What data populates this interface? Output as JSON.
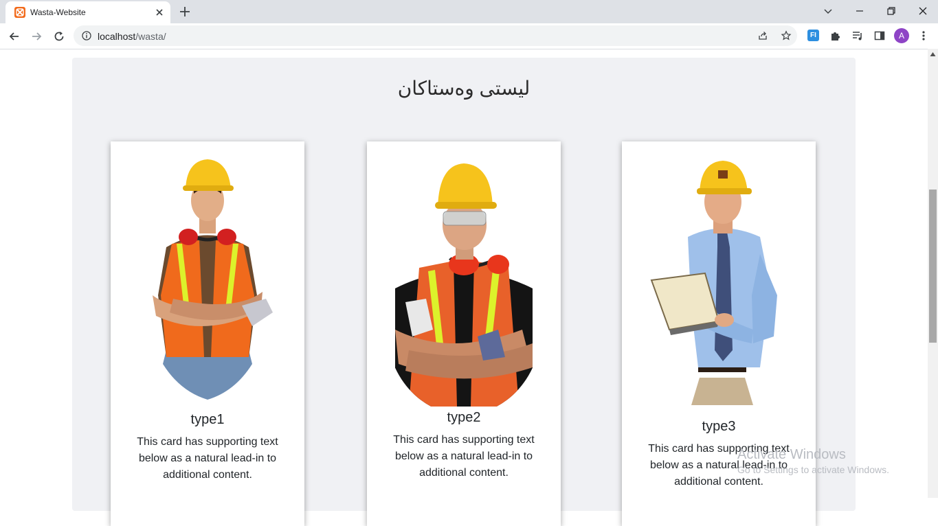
{
  "browser": {
    "tab_title": "Wasta-Website",
    "url_host": "localhost",
    "url_path": "/wasta/",
    "profile_initial": "A",
    "extension_label": "FI"
  },
  "page": {
    "heading": "لیستی وەستاکان",
    "cards": [
      {
        "title": "type1",
        "text": "This card has supporting text below as a natural lead-in to additional content.",
        "image": "worker-orange-vest-crossed-arms"
      },
      {
        "title": "type2",
        "text": "This card has supporting text below as a natural lead-in to additional content.",
        "image": "worker-safety-glasses-earmuffs"
      },
      {
        "title": "type3",
        "text": "This card has supporting text below as a natural lead-in to additional content.",
        "image": "engineer-blue-shirt-clipboard"
      }
    ]
  },
  "watermark": {
    "line1": "Activate Windows",
    "line2": "Go to Settings to activate Windows."
  },
  "icons": {
    "favicon": "xampp-icon",
    "back": "back-arrow-icon",
    "forward": "forward-arrow-icon",
    "reload": "reload-icon",
    "site_info": "info-icon",
    "share": "share-icon",
    "bookmark": "star-icon",
    "extensions": "puzzle-icon",
    "media": "media-queue-icon",
    "side_panel": "side-panel-icon",
    "menu": "kebab-menu-icon"
  },
  "colors": {
    "tabstrip": "#dee1e6",
    "section_bg": "#f0f1f4",
    "favicon": "#f26a1b",
    "avatar": "#8e44c6",
    "helmet": "#f6c31c"
  }
}
